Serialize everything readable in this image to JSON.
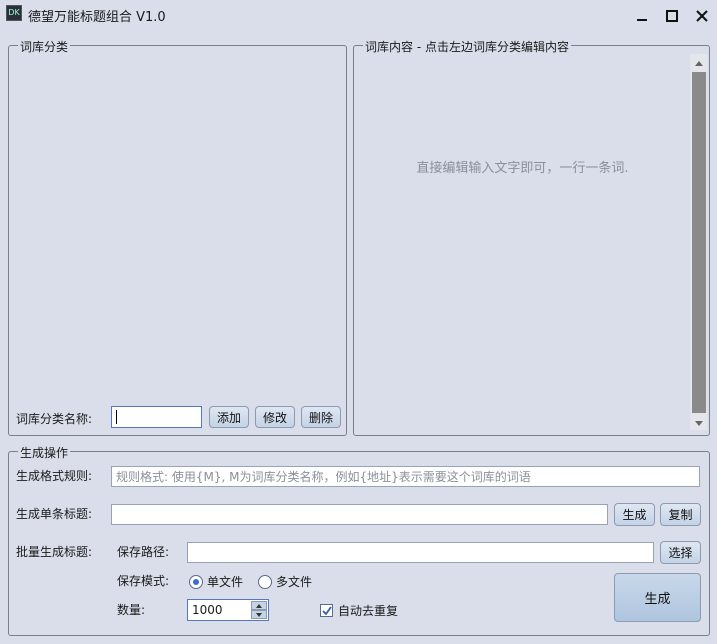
{
  "window": {
    "title": "德望万能标题组合 V1.0",
    "icon_text": "DK"
  },
  "left_panel": {
    "title": "词库分类",
    "name_label": "词库分类名称:",
    "name_value": "",
    "add_label": "添加",
    "edit_label": "修改",
    "delete_label": "删除"
  },
  "right_panel": {
    "title": "词库内容 - 点击左边词库分类编辑内容",
    "hint": "直接编辑输入文字即可，一行一条词."
  },
  "generate": {
    "title": "生成操作",
    "format_label": "生成格式规则:",
    "format_placeholder": "规则格式: 使用{M}, M为词库分类名称，例如{地址}表示需要这个词库的词语",
    "single_label": "生成单条标题:",
    "single_value": "",
    "single_generate_label": "生成",
    "copy_label": "复制",
    "batch_label": "批量生成标题:",
    "save_path_label": "保存路径:",
    "save_path_value": "",
    "choose_label": "选择",
    "save_mode_label": "保存模式:",
    "mode_single_label": "单文件",
    "mode_multi_label": "多文件",
    "mode_selected": "单文件",
    "count_label": "数量:",
    "count_value": "1000",
    "dedupe_label": "自动去重复",
    "dedupe_checked": true,
    "big_generate_label": "生成"
  },
  "colors": {
    "background": "#d9deea",
    "button": "#c4d3e6",
    "scrollbar_thumb": "#8a8a8a"
  }
}
